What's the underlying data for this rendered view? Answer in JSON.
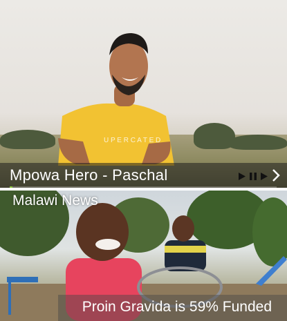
{
  "slider": {
    "title": "Mpowa Hero - Paschal",
    "progress": 0.01
  },
  "news": {
    "label": "Malawi News",
    "funded_text": "Proin Gravida is 59% Funded"
  },
  "colors": {
    "accent": "#8cc63f",
    "shirt": "#f2c232",
    "jacket": "#e7445e"
  },
  "icons": [
    "play-icon",
    "pause-icon",
    "stop-icon",
    "next-arrow-icon"
  ]
}
